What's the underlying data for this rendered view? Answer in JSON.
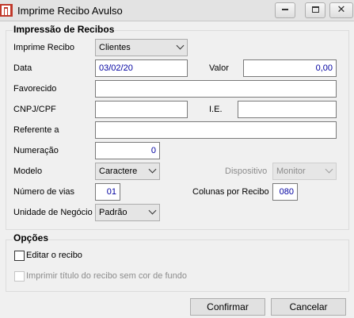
{
  "window": {
    "title": "Imprime Recibo Avulso",
    "close_symbol": "✕"
  },
  "section_impressao": {
    "legend": "Impressão de Recibos",
    "imprime_recibo": {
      "label": "Imprime Recibo",
      "value": "Clientes"
    },
    "data": {
      "label": "Data",
      "value": "03/02/20"
    },
    "valor": {
      "label": "Valor",
      "value": "0,00"
    },
    "favorecido": {
      "label": "Favorecido",
      "value": ""
    },
    "cnpj": {
      "label": "CNPJ/CPF",
      "value": "  .   .   /   -"
    },
    "ie": {
      "label": "I.E.",
      "value": ""
    },
    "referente": {
      "label": "Referente a",
      "value": ""
    },
    "numeracao": {
      "label": "Numeração",
      "value": "0"
    },
    "modelo": {
      "label": "Modelo",
      "value": "Caractere"
    },
    "dispositivo": {
      "label": "Dispositivo",
      "value": "Monitor"
    },
    "numero_vias": {
      "label": "Número de vias",
      "value": "01"
    },
    "colunas": {
      "label": "Colunas por Recibo",
      "value": "080"
    },
    "unidade": {
      "label": "Unidade de Negócio",
      "value": "Padrão"
    }
  },
  "section_opcoes": {
    "legend": "Opções",
    "editar": {
      "label": "Editar o recibo",
      "checked": false
    },
    "imprimir_titulo": {
      "label": "Imprimir título do recibo sem cor de fundo",
      "checked": false,
      "enabled": false
    }
  },
  "buttons": {
    "confirmar": "Confirmar",
    "cancelar": "Cancelar"
  },
  "colors": {
    "window_bg": "#f0f0f0",
    "value_text": "#0000a0",
    "app_icon": "#c0392b"
  }
}
